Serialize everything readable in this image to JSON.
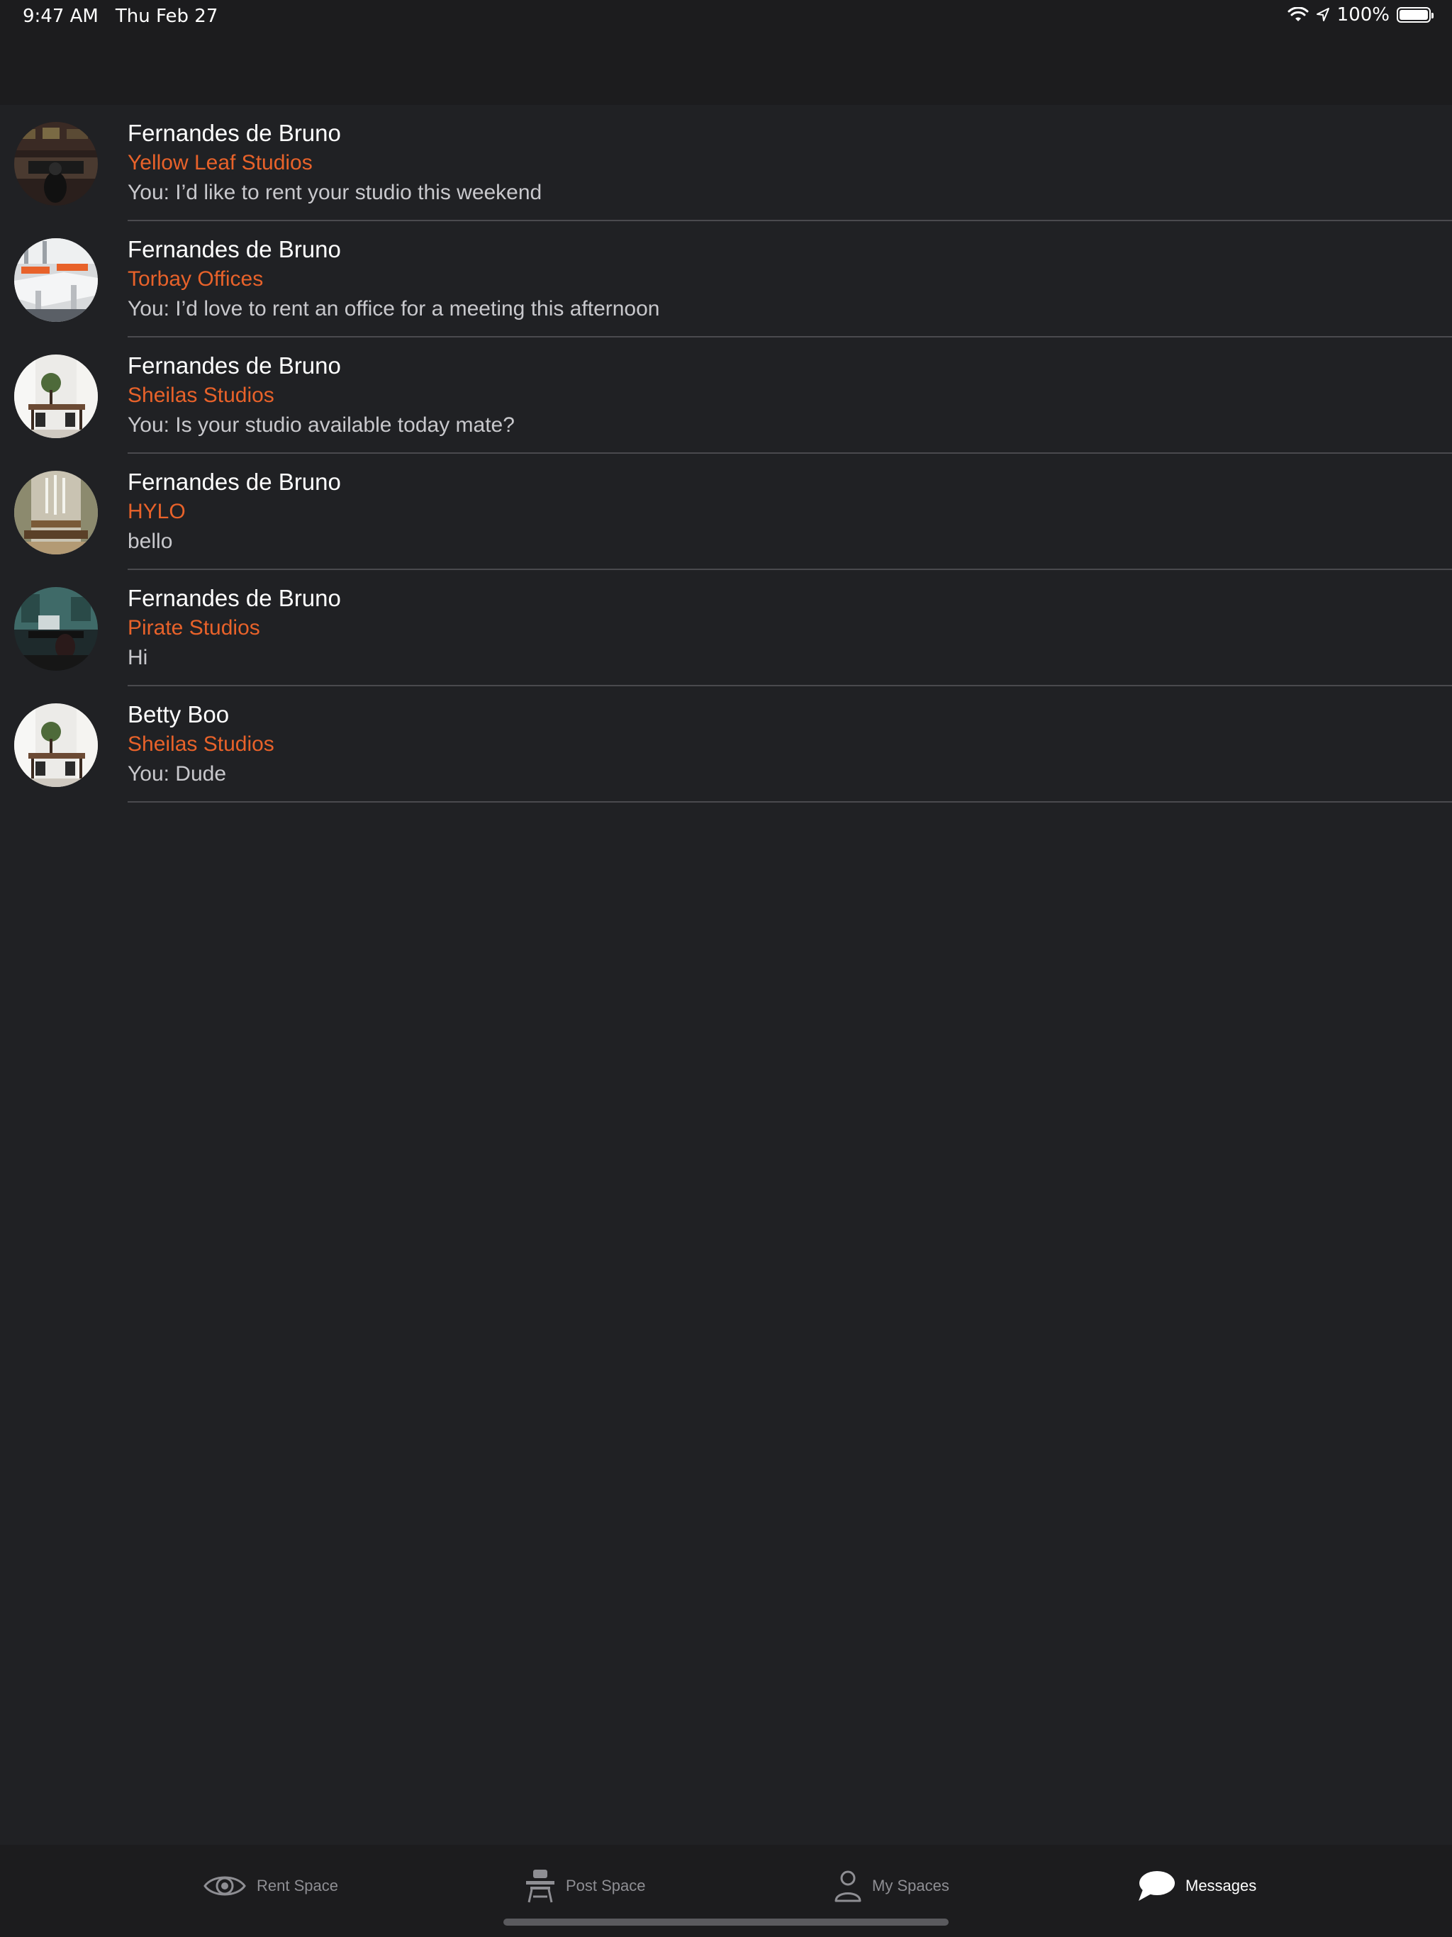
{
  "status": {
    "time": "9:47 AM",
    "date": "Thu Feb 27",
    "battery": "100%"
  },
  "conversations": [
    {
      "name": "Fernandes de Bruno",
      "space": "Yellow Leaf Studios",
      "preview": "You: I’d like to rent your studio this weekend",
      "avatar": "studio-photo"
    },
    {
      "name": "Fernandes de Bruno",
      "space": "Torbay Offices",
      "preview": "You: I’d love to rent an office for a meeting this afternoon",
      "avatar": "office-photo"
    },
    {
      "name": "Fernandes de Bruno",
      "space": "Sheilas Studios",
      "preview": "You: Is your studio available today mate?",
      "avatar": "room-photo"
    },
    {
      "name": "Fernandes de Bruno",
      "space": "HYLO",
      "preview": "bello",
      "avatar": "hall-photo"
    },
    {
      "name": "Fernandes de Bruno",
      "space": "Pirate Studios",
      "preview": "Hi",
      "avatar": "music-studio-photo"
    },
    {
      "name": "Betty Boo",
      "space": "Sheilas Studios",
      "preview": "You: Dude",
      "avatar": "room-photo"
    }
  ],
  "tabs": [
    {
      "label": "Rent Space",
      "icon": "eye-icon",
      "active": false
    },
    {
      "label": "Post Space",
      "icon": "desk-icon",
      "active": false
    },
    {
      "label": "My Spaces",
      "icon": "person-icon",
      "active": false
    },
    {
      "label": "Messages",
      "icon": "chat-bubble-icon",
      "active": true
    }
  ],
  "colors": {
    "background": "#202124",
    "bar": "#1c1c1e",
    "accent": "#e8622a",
    "divider": "#4a4a4e"
  }
}
